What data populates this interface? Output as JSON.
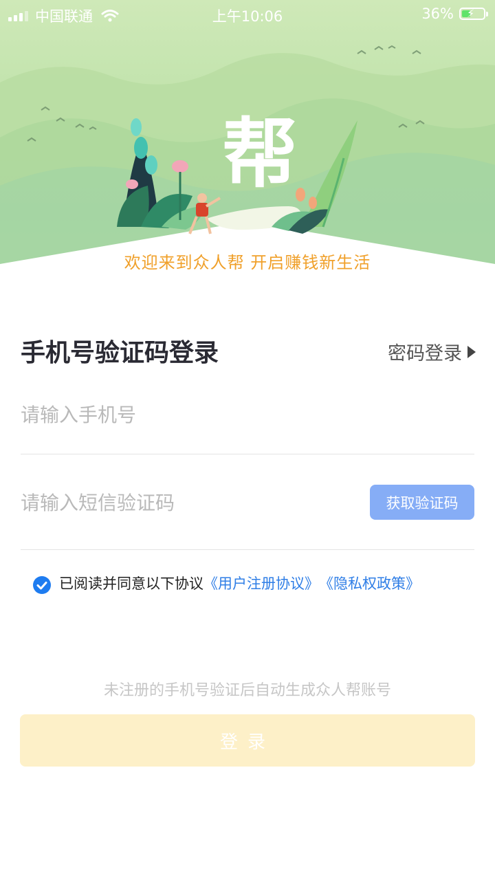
{
  "status_bar": {
    "carrier": "中国联通",
    "time": "上午10:06",
    "battery": "36%",
    "signal_bars": 4,
    "signal_active": 3,
    "battery_level": 0.36
  },
  "hero": {
    "logo_char": "帮",
    "welcome_text": "欢迎来到众人帮 开启赚钱新生活"
  },
  "form": {
    "title": "手机号验证码登录",
    "switch_label": "密码登录",
    "phone_placeholder": "请输入手机号",
    "phone_value": "",
    "code_placeholder": "请输入短信验证码",
    "code_value": "",
    "get_code_label": "获取验证码",
    "agree_text": "已阅读并同意以下协议",
    "agree_checked": true,
    "link_terms": "《用户注册协议》",
    "link_privacy": "《隐私权政策》",
    "hint": "未注册的手机号验证后自动生成众人帮账号",
    "login_label": "登录"
  },
  "colors": {
    "accent_blue": "#2f7ee6",
    "welcome_orange": "#f0a02a",
    "login_button": "#fdf0c8",
    "get_code_button": "#86adf6"
  },
  "icons": [
    "signal-icon",
    "wifi-icon",
    "battery-charging-icon",
    "chevron-right-icon",
    "checkmark-icon"
  ]
}
